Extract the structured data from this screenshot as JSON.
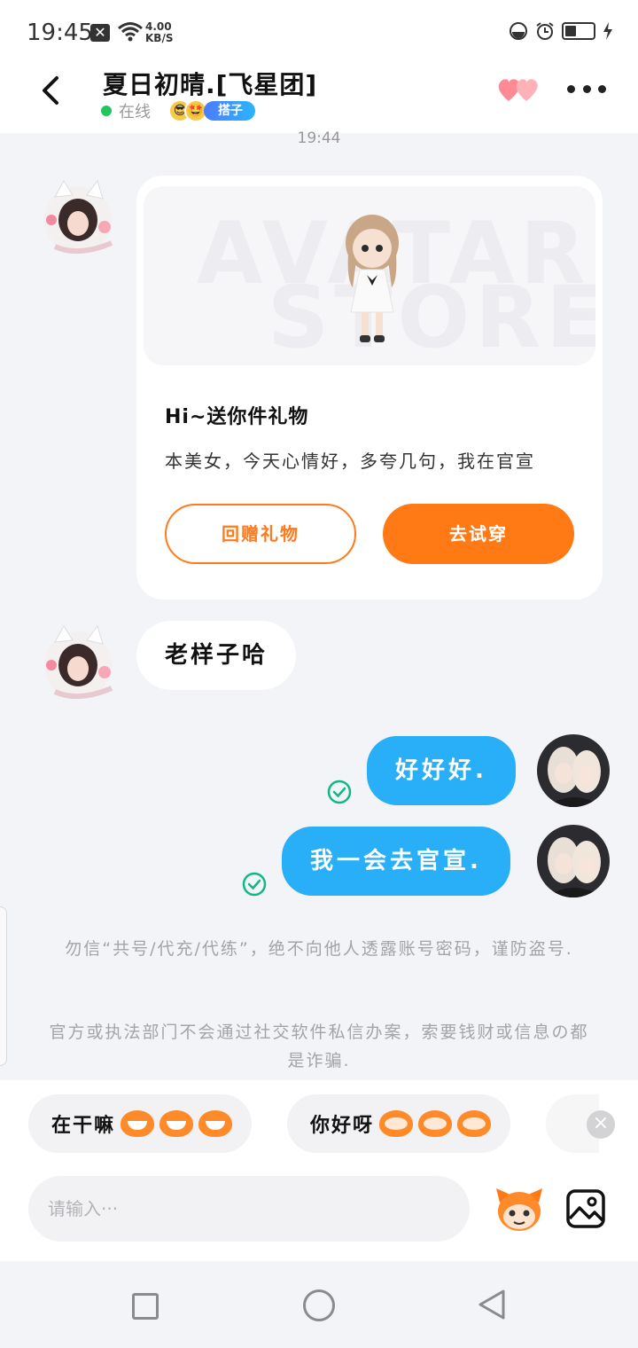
{
  "status_bar": {
    "time": "19:45",
    "notification_glyph": "✕",
    "speed_value": "4.00",
    "speed_unit": "KB/S",
    "icons": [
      "wifi-icon",
      "do-not-disturb-icon",
      "alarm-icon",
      "battery-icon",
      "charging-icon"
    ]
  },
  "header": {
    "title": "夏日初晴.[飞星团]",
    "online_label": "在线",
    "tag_label": "搭子",
    "badge_emojis": [
      "😎",
      "🤩"
    ]
  },
  "chat": {
    "timestamp": "19:44",
    "gift_card": {
      "watermark_line1": "AVATAR",
      "watermark_line2": "STORE",
      "title": "Hi~送你件礼物",
      "description": "本美女，今天心情好，多夸几句，我在官宣",
      "return_gift_label": "回赠礼物",
      "try_on_label": "去试穿"
    },
    "incoming_message": "老样子哈",
    "outgoing_messages": [
      "好好好.",
      "我一会去官宣."
    ]
  },
  "notices": [
    "勿信“共号/代充/代练”，绝不向他人透露账号密码，谨防盗号.",
    "官方或执法部门不会通过社交软件私信办案，索要钱财或信息の都是诈骗."
  ],
  "quick_replies": [
    {
      "label": "在干嘛"
    },
    {
      "label": "你好呀"
    }
  ],
  "input": {
    "placeholder": "请输入···"
  },
  "colors": {
    "accent_orange": "#ff7a14",
    "bubble_blue": "#29aef8",
    "online_green": "#22c55e",
    "check_green": "#10b981"
  }
}
